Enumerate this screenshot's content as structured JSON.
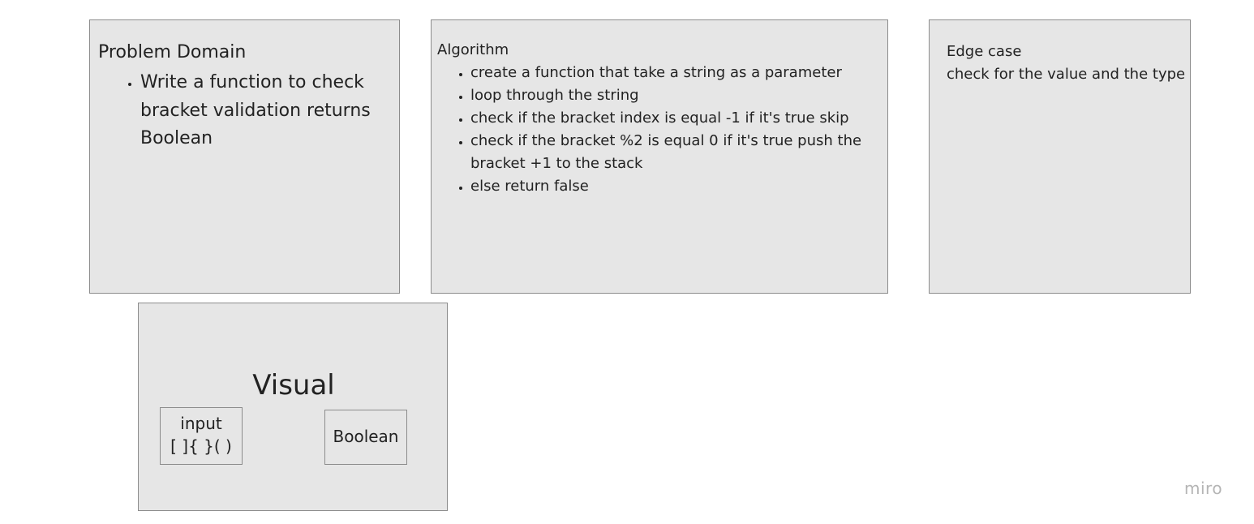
{
  "problem_domain": {
    "title": "Problem Domain",
    "items": [
      "Write a function to check bracket validation returns Boolean"
    ]
  },
  "algorithm": {
    "title": "Algorithm",
    "steps": [
      "create a function that take a string as a parameter",
      "loop through the string",
      "check if the bracket index is equal -1 if it's true skip",
      "check if the bracket %2 is equal 0 if it's true  push the bracket +1 to the stack",
      "else return false"
    ]
  },
  "edge_case": {
    "title": "Edge case",
    "text": "check for the value and the type"
  },
  "visual": {
    "title": "Visual",
    "input_label": "input",
    "input_value": "[ ]{ }( )",
    "output_label": "Boolean"
  },
  "logo": "miro",
  "colors": {
    "card_fill": "#e6e6e6",
    "card_border": "#8c8c8c",
    "text": "#222222",
    "logo": "#b5b5b5"
  }
}
